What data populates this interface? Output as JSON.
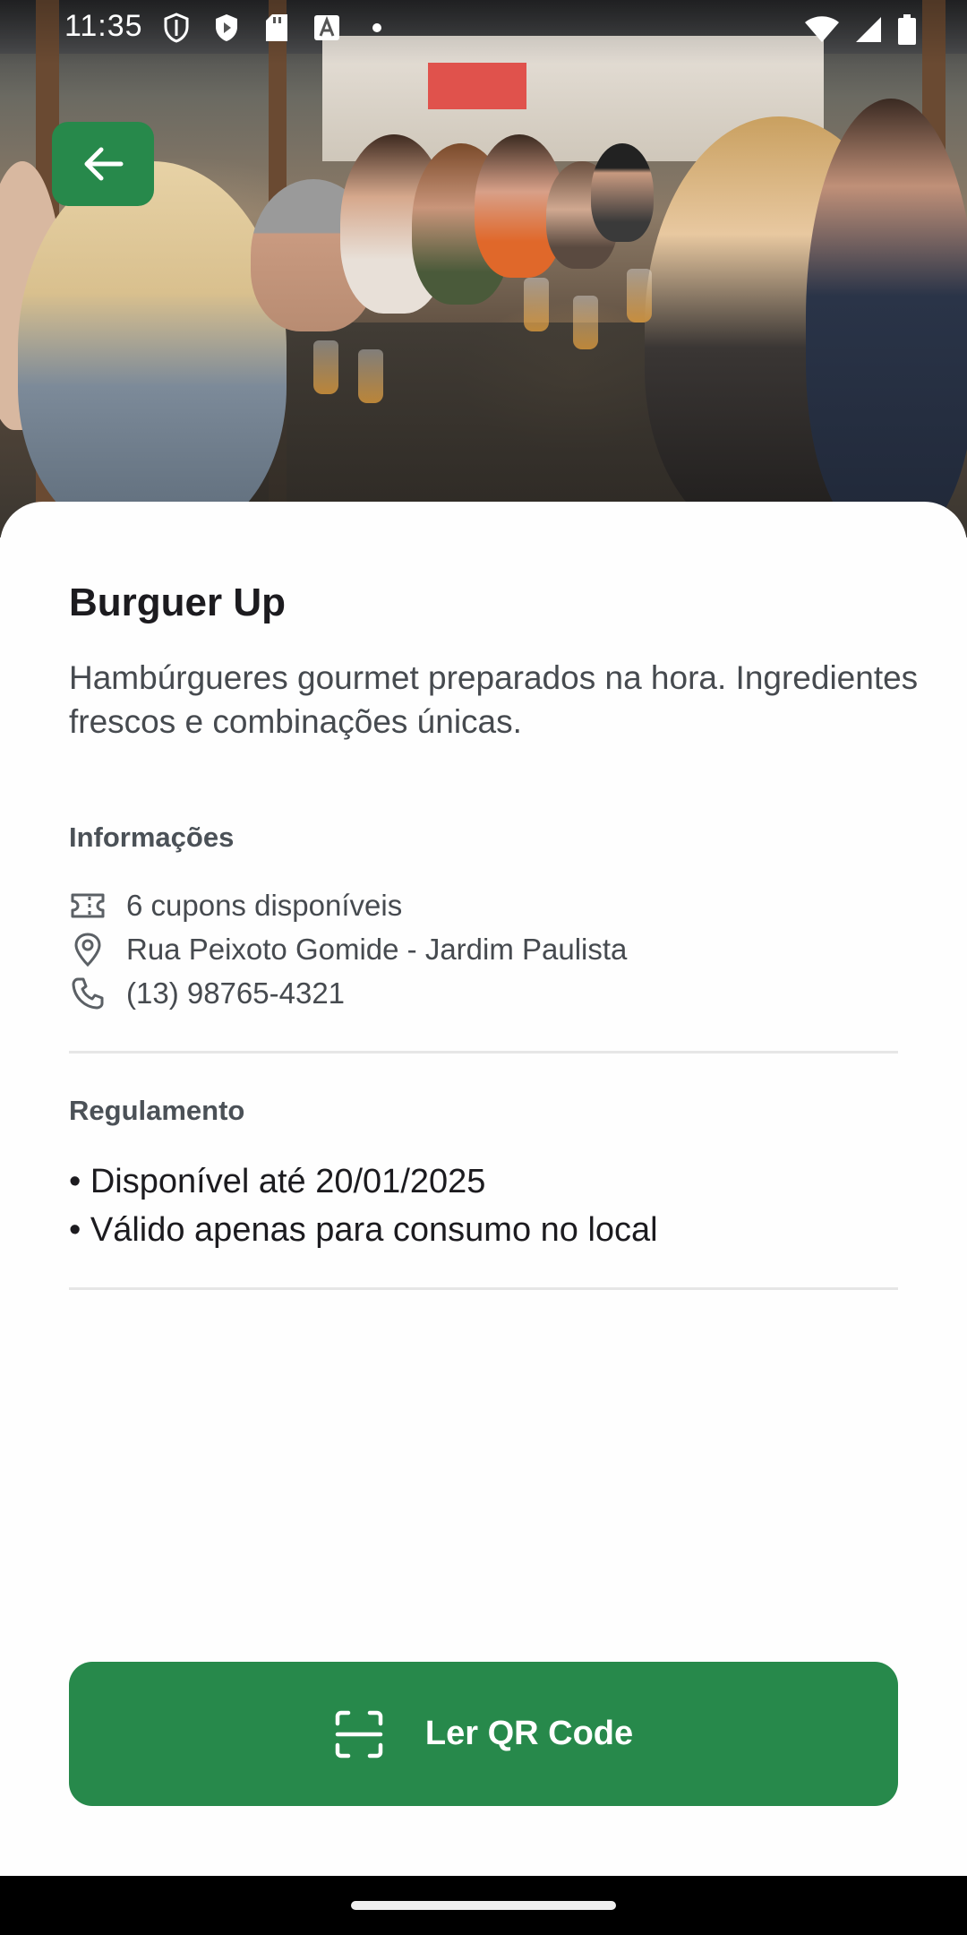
{
  "status_bar": {
    "time": "11:35",
    "icons": [
      "shield-icon",
      "play-protect-icon",
      "sd-card-icon",
      "font-a-icon",
      "dot-icon"
    ],
    "right_icons": [
      "wifi-icon",
      "signal-icon",
      "battery-icon"
    ]
  },
  "hero": {
    "image": "restaurant-people-dining-photo"
  },
  "back_button": {
    "icon": "arrow-left-icon"
  },
  "store": {
    "name": "Burguer Up",
    "description": "Hambúrgueres gourmet preparados na hora. Ingredientes frescos e combinações únicas."
  },
  "info": {
    "label": "Informações",
    "items": [
      {
        "icon": "ticket-icon",
        "text": "6 cupons disponíveis"
      },
      {
        "icon": "location-pin-icon",
        "text": "Rua Peixoto Gomide - Jardim Paulista"
      },
      {
        "icon": "phone-icon",
        "text": "(13) 98765-4321"
      }
    ]
  },
  "rules": {
    "label": "Regulamento",
    "items": [
      "• Disponível até 20/01/2025",
      "• Válido apenas para consumo no local"
    ]
  },
  "cta": {
    "label": "Ler QR Code",
    "icon": "qr-scan-icon"
  },
  "colors": {
    "primary": "#27894b",
    "text": "#1c1b1f",
    "muted": "#464a4f"
  }
}
